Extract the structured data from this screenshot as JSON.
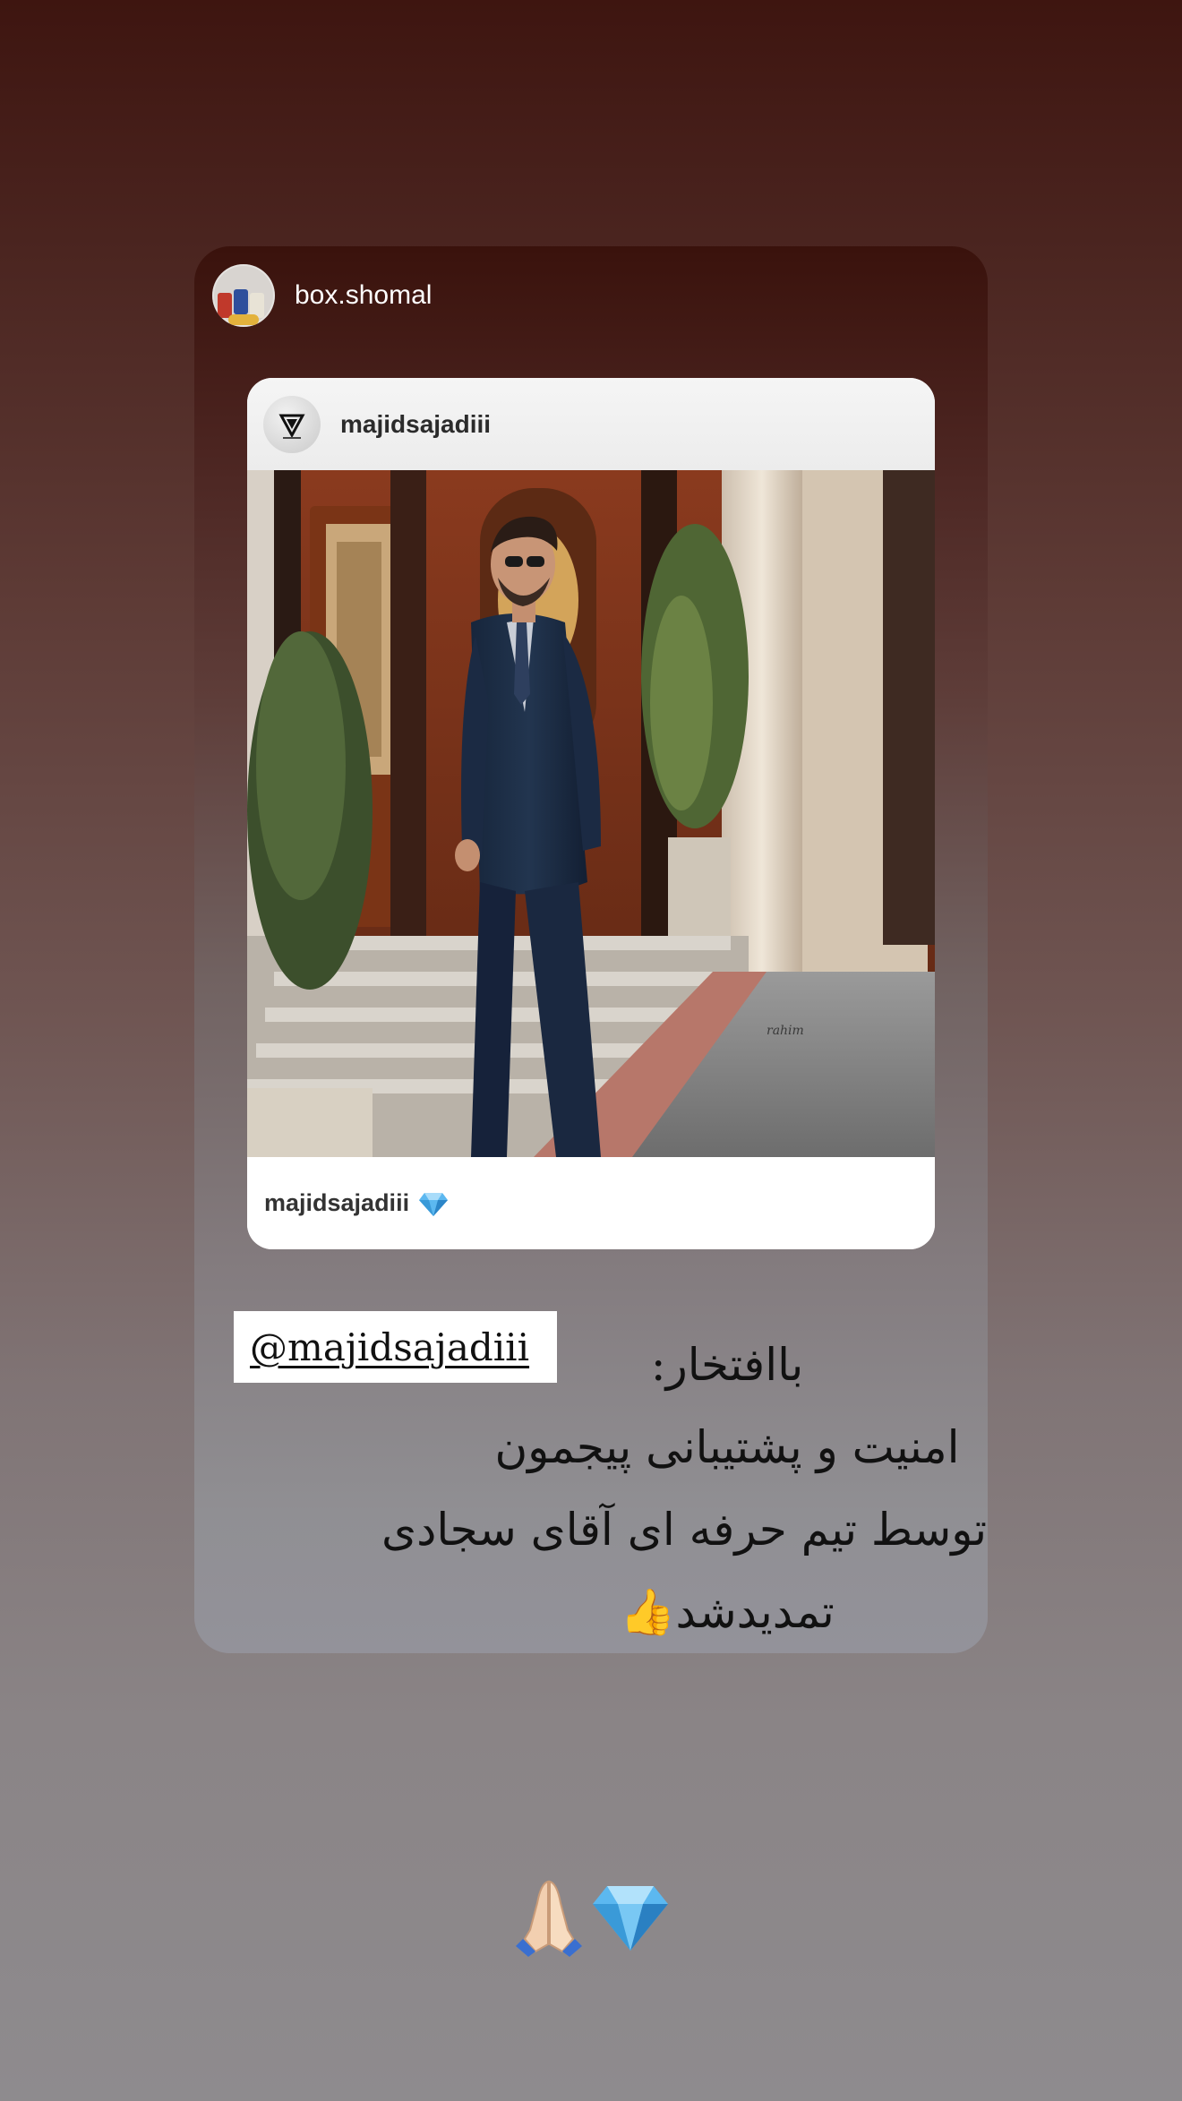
{
  "story": {
    "author": {
      "username": "box.shomal",
      "avatar_icon": "product-jars-avatar"
    },
    "shared_post": {
      "header_username": "majidsajadiii",
      "header_avatar_icon": "brand-logo-avatar",
      "photo_description_icon": "man-in-navy-suit-photo",
      "footer_username": "majidsajadiii",
      "footer_badge_icon": "gem-icon"
    },
    "mention_sticker": {
      "text": "@majidsajadiii"
    },
    "caption": {
      "lines": [
        "باافتخار:",
        "امنیت و پشتیبانی پیجمون",
        "توسط تیم حرفه ای آقای سجادی",
        "تمدیدشد👍"
      ]
    },
    "bottom_emojis": {
      "icons": [
        "folded-hands-icon",
        "gem-icon"
      ]
    },
    "colors": {
      "background_top": "#3e1510",
      "background_bottom": "#8e8b8e",
      "card_top": "#3a120c",
      "card_bottom": "#93929a"
    }
  }
}
